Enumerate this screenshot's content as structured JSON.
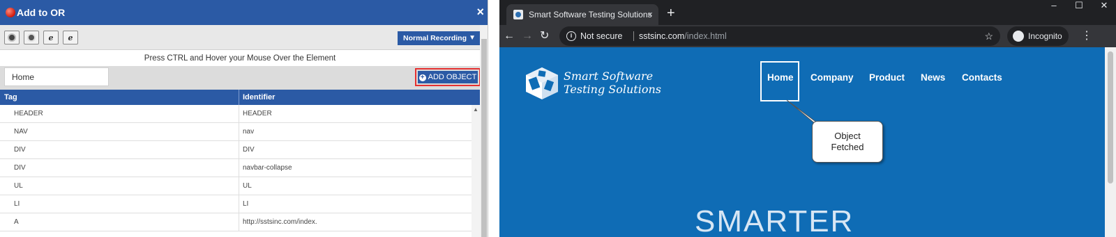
{
  "left_panel": {
    "title": "Add to OR",
    "close": "×",
    "recording_mode": "Normal Recording",
    "hint": "Press CTRL and Hover your Mouse Over the Element",
    "search": {
      "value": "Home"
    },
    "add_button": "ADD OBJECT",
    "table": {
      "headers": [
        "Tag",
        "Identifier"
      ],
      "rows": [
        {
          "tag": "HEADER",
          "identifier": "HEADER"
        },
        {
          "tag": "NAV",
          "identifier": "nav"
        },
        {
          "tag": "DIV",
          "identifier": "DIV"
        },
        {
          "tag": "DIV",
          "identifier": "navbar-collapse"
        },
        {
          "tag": "UL",
          "identifier": "UL"
        },
        {
          "tag": "LI",
          "identifier": "LI"
        },
        {
          "tag": "A",
          "identifier": "http://sstsinc.com/index."
        }
      ]
    },
    "browser_buttons": [
      "chrome-icon",
      "firefox-icon",
      "ie-icon",
      "edge-icon"
    ]
  },
  "browser": {
    "tab_title": "Smart Software Testing Solutions",
    "tab_close": "×",
    "new_tab": "+",
    "window_controls": [
      "–",
      "☐",
      "✕"
    ],
    "nav": {
      "back": "←",
      "forward": "→",
      "reload": "↻"
    },
    "security_label": "Not secure",
    "url_host": "sstsinc.com",
    "url_path": "/index.html",
    "star": "☆",
    "incognito_label": "Incognito",
    "menu": "⋮"
  },
  "site": {
    "logo_line1": "Smart Software",
    "logo_line2": "Testing Solutions",
    "menu": [
      "Home",
      "Company",
      "Product",
      "News",
      "Contacts"
    ],
    "callout_line1": "Object",
    "callout_line2": "Fetched",
    "hero": "SMARTER"
  },
  "colors": {
    "panel_blue": "#2b5aa5",
    "highlight_red": "#e53030",
    "site_blue": "#0f6cb5",
    "chrome_dark": "#202124"
  }
}
